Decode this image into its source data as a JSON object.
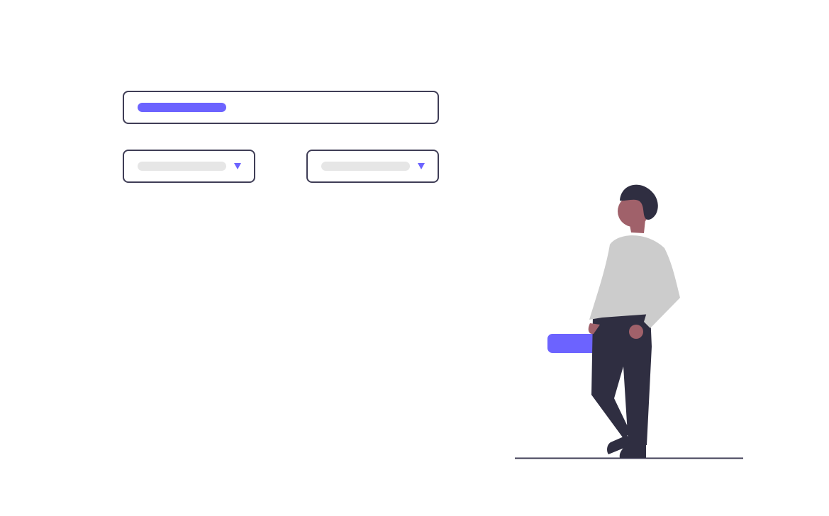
{
  "colors": {
    "accent": "#6c63ff",
    "outline": "#3f3d56",
    "placeholder_bar": "#e6e6e6",
    "shirt": "#cccccc",
    "skin": "#a0616a",
    "dark": "#2f2e41",
    "ground": "#3f3d56"
  },
  "icons": {
    "select_caret": "caret-down-icon"
  }
}
